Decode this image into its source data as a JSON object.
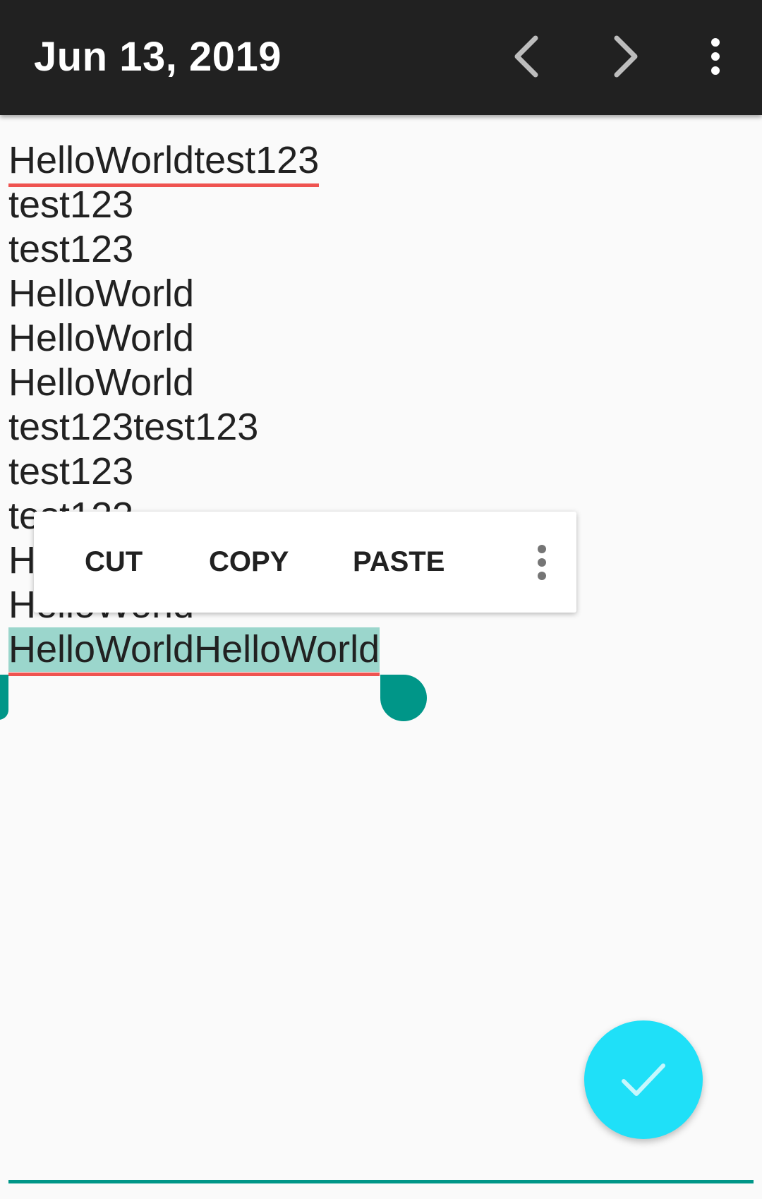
{
  "toolbar": {
    "title": "Jun 13, 2019",
    "prev_icon": "chevron-left-icon",
    "next_icon": "chevron-right-icon",
    "more_icon": "more-vertical-icon"
  },
  "editor": {
    "lines": [
      "HelloWorldtest123",
      "test123",
      "test123",
      "HelloWorld",
      "HelloWorld",
      "HelloWorld",
      "test123test123",
      "test123",
      "test123",
      "HelloWorld",
      "HelloWorld",
      "HelloWorldHelloWorld"
    ],
    "selected_text": "HelloWorldHelloWorld"
  },
  "context_menu": {
    "cut": "CUT",
    "copy": "COPY",
    "paste": "PASTE",
    "more_icon": "more-vertical-icon"
  },
  "fab": {
    "icon": "check-icon"
  },
  "colors": {
    "toolbar": "#212121",
    "accent": "#009688",
    "selection": "#9bd6cc",
    "fab": "#1fe0f8",
    "spell_error": "#ef5350"
  }
}
